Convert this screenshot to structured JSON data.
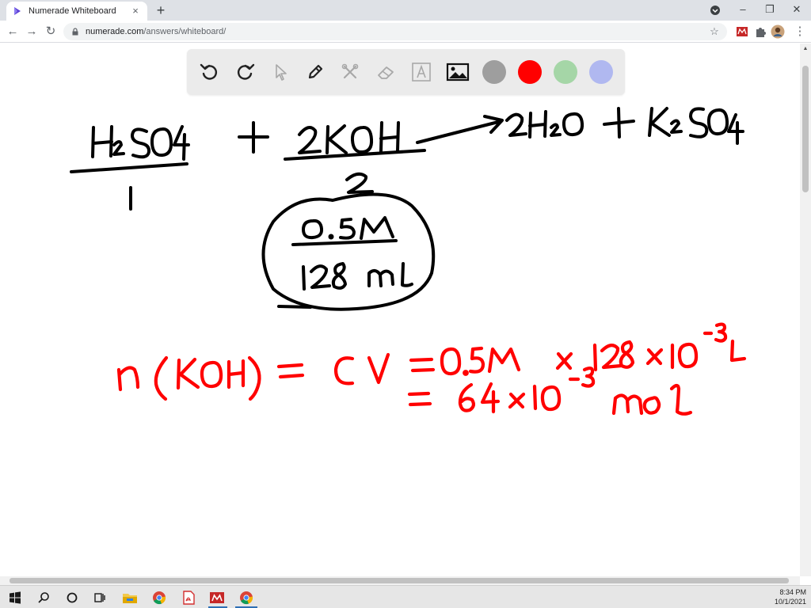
{
  "browser": {
    "tab_title": "Numerade Whiteboard",
    "tab_close": "×",
    "new_tab": "+",
    "url_host": "numerade.com",
    "url_path": "/answers/whiteboard/",
    "window_controls": {
      "minimize": "–",
      "restore": "❐",
      "close": "✕"
    },
    "nav": {
      "back": "←",
      "forward": "→",
      "reload": "↻"
    },
    "bookmark_icon": "star-icon",
    "menu_glyph": "⋮"
  },
  "whiteboard_toolbar": {
    "tools": [
      "undo-icon",
      "redo-icon",
      "select-icon",
      "pen-icon",
      "tools-icon",
      "eraser-icon",
      "text-icon",
      "image-icon"
    ],
    "colors": [
      "#9e9e9e",
      "#ff0000",
      "#a5d6a7",
      "#b0b8f0"
    ]
  },
  "whiteboard": {
    "black_ink_color": "#000000",
    "red_ink_color": "#ff0000"
  },
  "taskbar": {
    "apps": [
      "windows-start-icon",
      "search-icon",
      "cortana-icon",
      "task-view-icon",
      "file-explorer-icon",
      "chrome-icon",
      "pdf-icon",
      "numerade-icon",
      "chrome-active-icon"
    ],
    "time": "8:34 PM",
    "date": "10/1/2021"
  }
}
